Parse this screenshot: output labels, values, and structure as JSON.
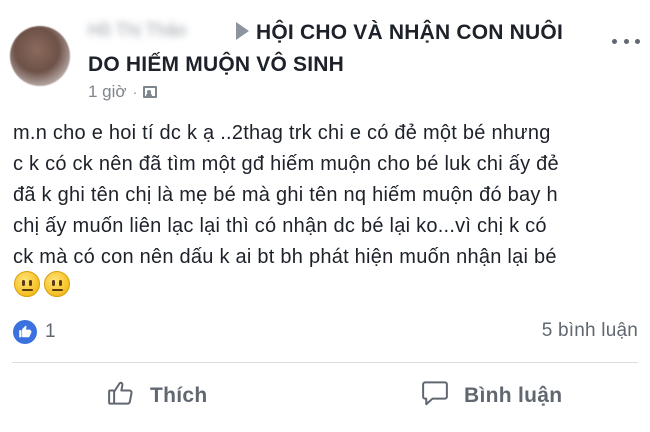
{
  "header": {
    "author_name": "Hồ Thị Thảo",
    "group_title_line1": "HỘI CHO VÀ NHẬN CON NUÔI",
    "group_title_line2": "DO HIẾM MUỘN VÔ SINH",
    "time": "1 giờ",
    "separator": "·"
  },
  "post": {
    "lines": [
      "m.n cho e hoi tí dc k ạ ..2thag trk chi e có đẻ một bé nhưng",
      "c k có ck nên đã tìm một gđ hiếm muộn cho bé luk chi ấy đẻ",
      "đã k ghi tên chị là mẹ bé mà ghi tên nq hiếm muộn đó bay h",
      "chị ấy muốn liên lạc lại thì có nhận dc bé lại ko...vì chị k có",
      "ck mà có con nên dấu k ai bt bh phát hiện muốn nhận lại bé"
    ],
    "emojis": [
      "neutral-face",
      "neutral-face"
    ]
  },
  "stats": {
    "reaction_count": "1",
    "comment_count": "5 bình luận"
  },
  "actions": {
    "like_label": "Thích",
    "comment_label": "Bình luận"
  },
  "colors": {
    "text": "#1d2129",
    "muted": "#606770",
    "like_blue": "#3b72e0",
    "divider": "#dadde1"
  }
}
